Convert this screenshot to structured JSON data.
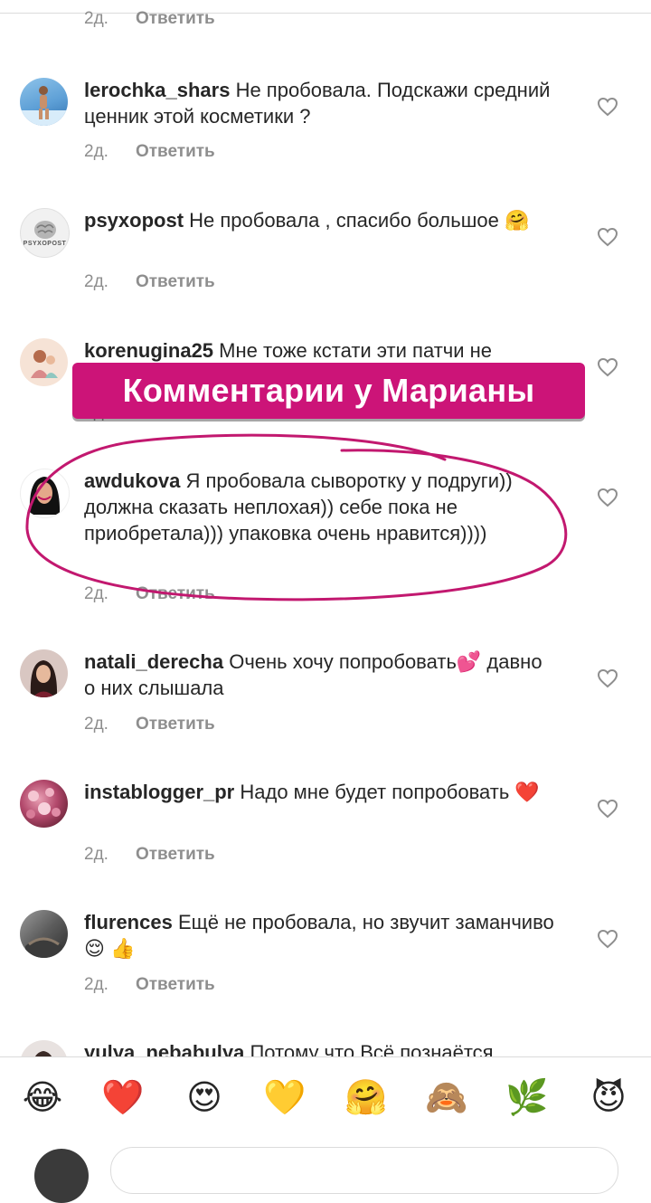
{
  "top_partial": {
    "time": "2д.",
    "reply": "Ответить"
  },
  "comments": [
    {
      "user": "lerochka_shars",
      "text": "Не пробовала. Подскажи средний ценник этой косметики ?",
      "time": "2д.",
      "reply": "Ответить"
    },
    {
      "user": "psyxopost",
      "text": "Не пробовала , спасибо большое 🤗",
      "avatar_label": "PSYXOPOST",
      "time": "2д.",
      "reply": "Ответить"
    },
    {
      "user": "korenugina25",
      "text": "Мне тоже кстати эти патчи не",
      "time": "2д.",
      "reply": "Ответить"
    },
    {
      "user": "awdukova",
      "text": "Я пробовала сыворотку у подруги)) должна сказать неплохая)) себе пока не приобретала))) упаковка очень нравится))))",
      "time": "2д.",
      "reply": "Ответить"
    },
    {
      "user": "natali_derecha",
      "text": "Очень хочу попробовать💕 давно о них слышала",
      "time": "2д.",
      "reply": "Ответить"
    },
    {
      "user": "instablogger_pr",
      "text": "Надо мне будет попробовать ❤️",
      "time": "2д.",
      "reply": "Ответить"
    },
    {
      "user": "flurences",
      "text": "Ещё не пробовала, но звучит заманчиво😌 👍",
      "time": "2д.",
      "reply": "Ответить"
    },
    {
      "user": "yulya_nebabulya",
      "text": "Потому что Всё познаётся"
    }
  ],
  "banner": {
    "text": "Комментарии у Марианы"
  },
  "quick_emojis": [
    "😂",
    "❤️",
    "😍",
    "💛",
    "🤗",
    "🙈",
    "🌿",
    "😈"
  ],
  "colors": {
    "accent_banner": "#cc1478",
    "circle_stroke": "#c2186f",
    "meta_text": "#8e8e8e"
  }
}
